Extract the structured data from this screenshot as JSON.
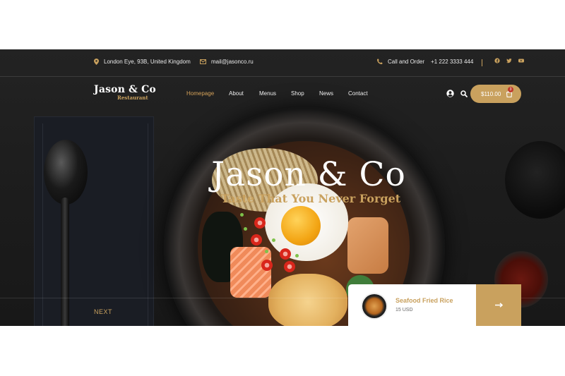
{
  "topbar": {
    "address": "London Eye, 93B, United Kingdom",
    "email": "mail@jasonco.ru",
    "call_label": "Call and Order",
    "phone": "+1 222 3333 444",
    "social": [
      "facebook-icon",
      "twitter-icon",
      "youtube-icon"
    ]
  },
  "brand": {
    "name": "Jason & Co",
    "tagline": "Restaurant"
  },
  "nav": {
    "items": [
      "Homepage",
      "About",
      "Menus",
      "Shop",
      "News",
      "Contact"
    ],
    "active": "Homepage"
  },
  "cart": {
    "total": "$110.00",
    "count": "3"
  },
  "hero": {
    "title": "Jason & Co",
    "subtitle": "Taste That You Never Forget",
    "next_label": "NEXT"
  },
  "feature_card": {
    "name": "Seafood Fried Rice",
    "price": "15 USD"
  },
  "colors": {
    "accent": "#c9a15e",
    "dark": "#1f1f1f",
    "badge": "#c0392b"
  }
}
